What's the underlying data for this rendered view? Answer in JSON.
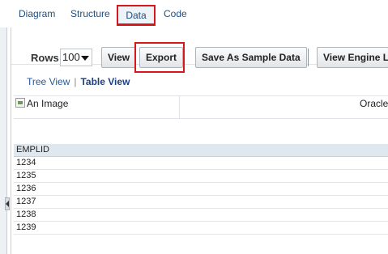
{
  "tabs": [
    {
      "label": "Diagram"
    },
    {
      "label": "Structure"
    },
    {
      "label": "Data"
    },
    {
      "label": "Code"
    }
  ],
  "toolbar": {
    "rows_label": "Rows",
    "rows_value": "100",
    "view_label": "View",
    "export_label": "Export",
    "sample_label": "Save As Sample Data",
    "engine_label": "View Engine L"
  },
  "view_switch": {
    "tree": "Tree View",
    "separator": "|",
    "table": "Table View"
  },
  "image_row": {
    "alt": "An Image",
    "text": "Oracle"
  },
  "table": {
    "header": "EMPLID",
    "rows": [
      "1234",
      "1235",
      "1236",
      "1237",
      "1238",
      "1239"
    ]
  },
  "highlight_color": "#d6171b",
  "icons": [
    "dropdown-caret-icon",
    "collapse-arrow-icon",
    "broken-image-icon"
  ]
}
